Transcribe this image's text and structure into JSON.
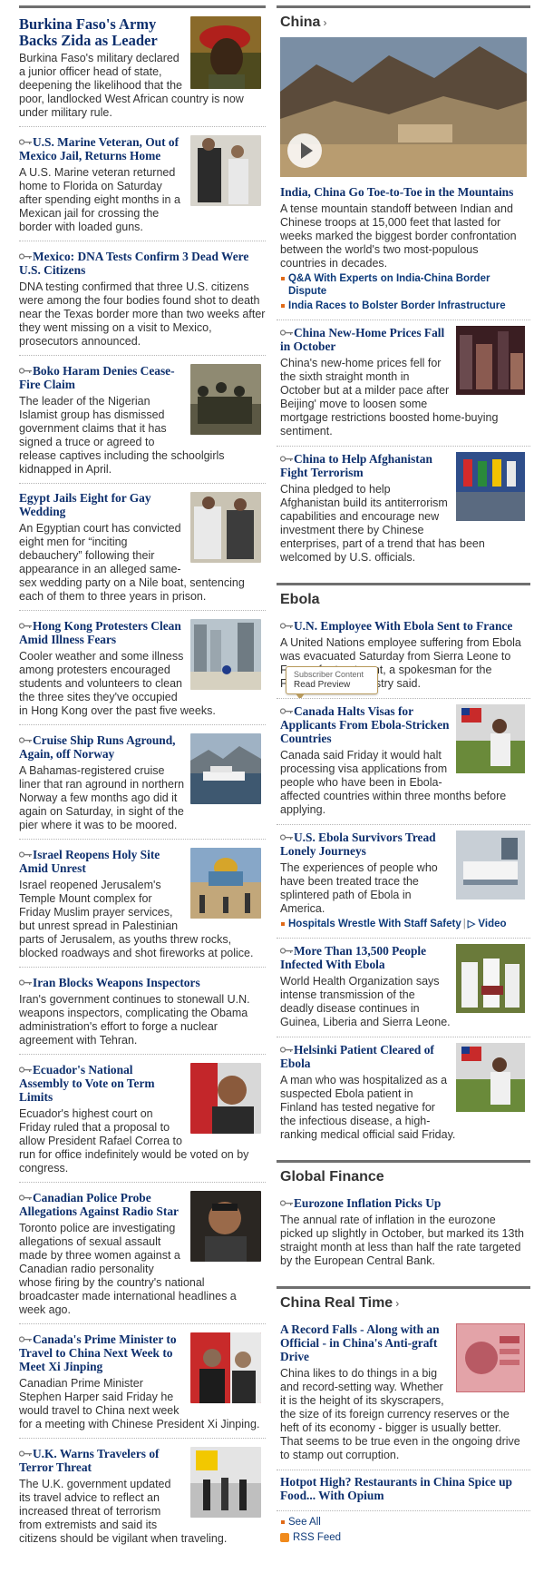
{
  "left_stories": [
    {
      "headline": "Burkina Faso's Army Backs Zida as Leader",
      "summary": "Burkina Faso's military declared a junior officer head of state, deepening the likelihood that the poor, landlocked West African country is now under military rule."
    },
    {
      "headline": "U.S. Marine Veteran, Out of Mexico Jail, Returns Home",
      "summary": "A U.S. Marine veteran returned home to Florida on Saturday after spending eight months in a Mexican jail for crossing the border with loaded guns."
    },
    {
      "headline": "Mexico: DNA Tests Confirm 3 Dead Were U.S. Citizens",
      "summary": "DNA testing confirmed that three U.S. citizens were among the four bodies found shot to death near the Texas border more than two weeks after they went missing on a visit to Mexico, prosecutors announced."
    },
    {
      "headline": "Boko Haram Denies Cease-Fire Claim",
      "summary": "The leader of the Nigerian Islamist group has dismissed government claims that it has signed a truce or agreed to release captives including the schoolgirls kidnapped in April."
    },
    {
      "headline": "Egypt Jails Eight for Gay Wedding",
      "summary": "An Egyptian court has convicted eight men for “inciting debauchery” following their appearance in an alleged same-sex wedding party on a Nile boat, sentencing each of them to three years in prison."
    },
    {
      "headline": "Hong Kong Protesters Clean Amid Illness Fears",
      "summary": "Cooler weather and some illness among protesters encouraged students and volunteers to clean the three sites they've occupied in Hong Kong over the past five weeks."
    },
    {
      "headline": "Cruise Ship Runs Aground, Again, off Norway",
      "summary": "A Bahamas-registered cruise liner that ran aground in northern Norway a few months ago did it again on Saturday, in sight of the pier where it was to be moored."
    },
    {
      "headline": "Israel Reopens Holy Site Amid Unrest",
      "summary": "Israel reopened Jerusalem's Temple Mount complex for Friday Muslim prayer services, but unrest spread in Palestinian parts of Jerusalem, as youths threw rocks, blocked roadways and shot fireworks at police."
    },
    {
      "headline": "Iran Blocks Weapons Inspectors",
      "summary": "Iran's government continues to stonewall U.N. weapons inspectors, complicating the Obama administration's effort to forge a nuclear agreement with Tehran."
    },
    {
      "headline": "Ecuador's National Assembly to Vote on Term Limits",
      "summary": "Ecuador's highest court on Friday ruled that a proposal to allow President Rafael Correa to run for office indefinitely would be voted on by congress."
    },
    {
      "headline": "Canadian Police Probe Allegations Against Radio Star",
      "summary": "Toronto police are investigating allegations of sexual assault made by three women against a Canadian radio personality whose firing by the country's national broadcaster made international headlines a week ago."
    },
    {
      "headline": "Canada's Prime Minister to Travel to China Next Week to Meet Xi Jinping",
      "summary": "Canadian Prime Minister Stephen Harper said Friday he would travel to China next week for a meeting with Chinese President Xi Jinping."
    },
    {
      "headline": "U.K. Warns Travelers of Terror Threat",
      "summary": "The U.K. government updated its travel advice to reflect an increased threat of terrorism from extremists and said its citizens should be vigilant when traveling."
    }
  ],
  "china": {
    "title": "China",
    "chevron": "›",
    "lead_headline": "India, China Go Toe-to-Toe in the Mountains",
    "lead_summary": "A tense mountain standoff between Indian and Chinese troops at 15,000 feet that lasted for weeks marked the biggest border confrontation between the world's two most-populous countries in decades.",
    "related": [
      "Q&A With Experts on India-China Border Dispute",
      "India Races to Bolster Border Infrastructure"
    ],
    "items": [
      {
        "headline": "China New-Home Prices Fall in October",
        "summary": "China's new-home prices fell for the sixth straight month in October but at a milder pace after Beijing' move to loosen some mortgage restrictions boosted home-buying sentiment."
      },
      {
        "headline": "China to Help Afghanistan Fight Terrorism",
        "summary": "China pledged to help Afghanistan build its antiterrorism capabilities and encourage new investment there by Chinese enterprises, part of a trend that has been welcomed by U.S. officials."
      }
    ]
  },
  "ebola": {
    "title": "Ebola",
    "items": [
      {
        "headline": "U.N. Employee With Ebola Sent to France",
        "summary": "A United Nations employee suffering from Ebola was evacuated Saturday from Sierra Leone to France for treatment, a spokesman for the French Health Ministry said."
      },
      {
        "headline": "Canada Halts Visas for Applicants From Ebola-Stricken Countries",
        "summary": "Canada said Friday it would halt processing visa applications from people who have been in Ebola-affected countries within three months before applying."
      },
      {
        "headline": "U.S. Ebola Survivors Tread Lonely Journeys",
        "summary": "The experiences of people who have been treated trace the splintered path of Ebola in America."
      },
      {
        "headline": "More Than 13,500 People Infected With Ebola",
        "summary": "World Health Organization says intense transmission of the deadly disease continues in Guinea, Liberia and Sierra Leone."
      },
      {
        "headline": "Helsinki Patient Cleared of Ebola",
        "summary": "A man who was hospitalized as a suspected Ebola patient in Finland has tested negative for the infectious disease, a high-ranking medical official said Friday."
      }
    ],
    "related_link": "Hospitals Wrestle With Staff Safety",
    "separator": "|",
    "video_label": "Video",
    "tooltip_line1": "Subscriber Content",
    "tooltip_line2": "Read Preview"
  },
  "global_finance": {
    "title": "Global Finance",
    "items": [
      {
        "headline": "Eurozone Inflation Picks Up",
        "summary": "The annual rate of inflation in the eurozone picked up slightly in October, but marked its 13th straight month at less than half the rate targeted by the European Central Bank."
      }
    ]
  },
  "china_real_time": {
    "title": "China Real Time",
    "chevron": "›",
    "items": [
      {
        "headline": "A Record Falls - Along with an Official - in China's Anti-graft Drive",
        "summary": "China likes to do things in a big and record-setting way. Whether it is the height of its skyscrapers, the size of its foreign currency reserves or the heft of its economy - bigger is usually better. That seems to be true even in the ongoing drive to stamp out corruption."
      },
      {
        "headline": "Hotpot High? Restaurants in China Spice up Food... With Opium",
        "summary": ""
      }
    ],
    "see_all": "See All",
    "rss": "RSS Feed"
  },
  "colors": {
    "headline": "#0d2f6d",
    "section_rule": "#6f6f6f",
    "bullet": "#e06a18"
  }
}
